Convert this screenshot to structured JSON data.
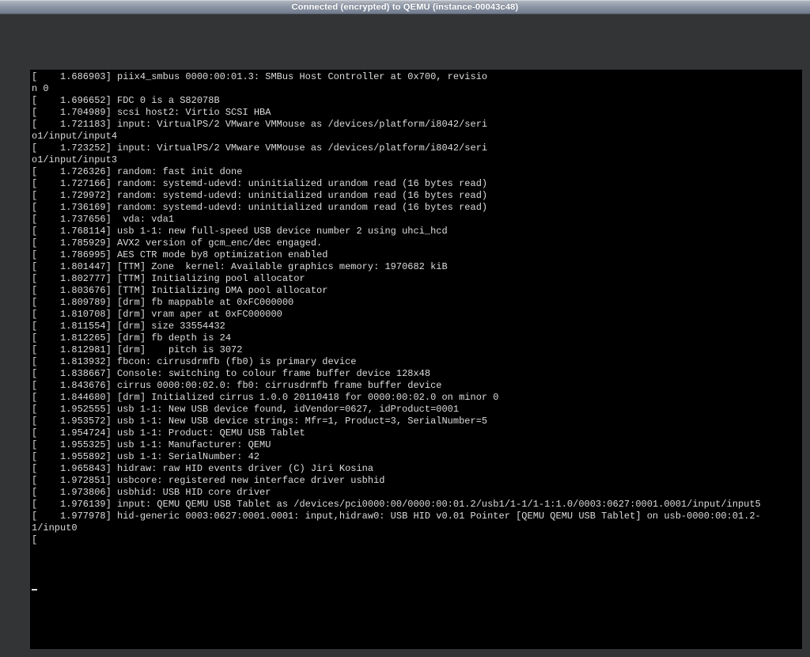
{
  "titlebar": {
    "text": "Connected (encrypted) to QEMU (instance-00043c48)"
  },
  "terminal": {
    "lines": [
      "[    1.686903] piix4_smbus 0000:00:01.3: SMBus Host Controller at 0x700, revisio",
      "n 0",
      "[    1.696652] FDC 0 is a S82078B",
      "[    1.704989] scsi host2: Virtio SCSI HBA",
      "[    1.721183] input: VirtualPS/2 VMware VMMouse as /devices/platform/i8042/seri",
      "o1/input/input4",
      "[    1.723252] input: VirtualPS/2 VMware VMMouse as /devices/platform/i8042/seri",
      "o1/input/input3",
      "[    1.726326] random: fast init done",
      "[    1.727166] random: systemd-udevd: uninitialized urandom read (16 bytes read)",
      "[    1.729972] random: systemd-udevd: uninitialized urandom read (16 bytes read)",
      "[    1.736169] random: systemd-udevd: uninitialized urandom read (16 bytes read)",
      "[    1.737656]  vda: vda1",
      "[    1.768114] usb 1-1: new full-speed USB device number 2 using uhci_hcd",
      "[    1.785929] AVX2 version of gcm_enc/dec engaged.",
      "[    1.786995] AES CTR mode by8 optimization enabled",
      "[    1.801447] [TTM] Zone  kernel: Available graphics memory: 1970682 kiB",
      "[    1.802777] [TTM] Initializing pool allocator",
      "[    1.803676] [TTM] Initializing DMA pool allocator",
      "[    1.809789] [drm] fb mappable at 0xFC000000",
      "[    1.810708] [drm] vram aper at 0xFC000000",
      "[    1.811554] [drm] size 33554432",
      "[    1.812265] [drm] fb depth is 24",
      "[    1.812981] [drm]    pitch is 3072",
      "[    1.813932] fbcon: cirrusdrmfb (fb0) is primary device",
      "[    1.838667] Console: switching to colour frame buffer device 128x48",
      "[    1.843676] cirrus 0000:00:02.0: fb0: cirrusdrmfb frame buffer device",
      "[    1.844680] [drm] Initialized cirrus 1.0.0 20110418 for 0000:00:02.0 on minor 0",
      "[    1.952555] usb 1-1: New USB device found, idVendor=0627, idProduct=0001",
      "[    1.953572] usb 1-1: New USB device strings: Mfr=1, Product=3, SerialNumber=5",
      "[    1.954724] usb 1-1: Product: QEMU USB Tablet",
      "[    1.955325] usb 1-1: Manufacturer: QEMU",
      "[    1.955892] usb 1-1: SerialNumber: 42",
      "[    1.965843] hidraw: raw HID events driver (C) Jiri Kosina",
      "[    1.972851] usbcore: registered new interface driver usbhid",
      "[    1.973806] usbhid: USB HID core driver",
      "[    1.976139] input: QEMU QEMU USB Tablet as /devices/pci0000:00/0000:00:01.2/usb1/1-1/1-1:1.0/0003:0627:0001.0001/input/input5",
      "[    1.977978] hid-generic 0003:0627:0001.0001: input,hidraw0: USB HID v0.01 Pointer [QEMU QEMU USB Tablet] on usb-0000:00:01.2-",
      "1/input0",
      "["
    ]
  }
}
